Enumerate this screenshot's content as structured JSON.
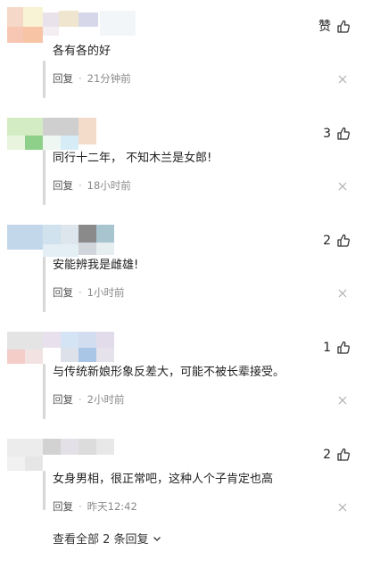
{
  "comments": [
    {
      "text": "各有各的好",
      "reply_label": "回复",
      "time": "21分钟前",
      "like_label": "赞"
    },
    {
      "text": "同行十二年， 不知木兰是女郎!",
      "reply_label": "回复",
      "time": "18小时前",
      "like_count": "3"
    },
    {
      "text": "安能辨我是雌雄!",
      "reply_label": "回复",
      "time": "1小时前",
      "like_count": "2"
    },
    {
      "text": "与传统新娘形象反差大，可能不被长辈接受。",
      "reply_label": "回复",
      "time": "2小时前",
      "like_count": "1"
    },
    {
      "text": "女身男相，很正常吧，这种人个子肯定也高",
      "reply_label": "回复",
      "time": "昨天12:42",
      "like_count": "2"
    }
  ],
  "view_more": "查看全部 2 条回复",
  "icons": {
    "like": "thumbs-up-icon",
    "close": "close-icon",
    "expand": "chevron-down-icon"
  },
  "colors": {
    "text": "#222222",
    "meta": "#8a8a8a",
    "divider": "#d7d7d7"
  }
}
